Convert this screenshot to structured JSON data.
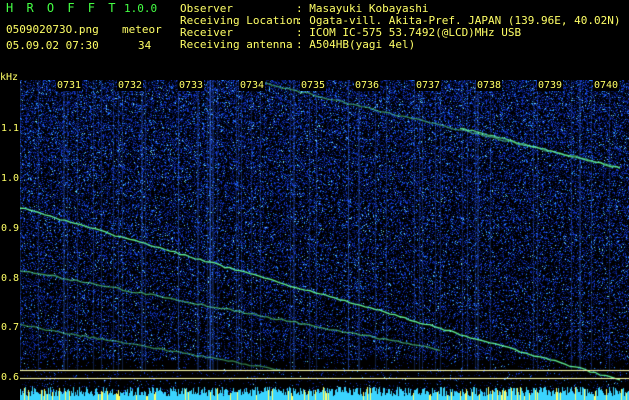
{
  "header": {
    "app_name": "H R O F F T",
    "version": "1.0.0",
    "filename": "050902073O.png",
    "meteor_label": "meteor",
    "datetime": "05.09.02 07:30",
    "meteor_count": "34"
  },
  "station": {
    "observer_label": "Observer",
    "observer_value": ": Masayuki Kobayashi",
    "location_label": "Receiving Location",
    "location_value": ": Ogata-vill. Akita-Pref. JAPAN (139.96E, 40.02N)",
    "receiver_label": "Receiver",
    "receiver_value": ": ICOM IC-575 53.7492(@LCD)MHz USB",
    "antenna_label": "Receiving antenna",
    "antenna_value": ": A504HB(yagi 4el)"
  },
  "axes": {
    "y_unit": "kHz",
    "y_ticks": [
      "1.1",
      "1.0",
      "0.9",
      "0.8",
      "0.7",
      "0.6"
    ],
    "x_ticks": [
      "0731",
      "0732",
      "0733",
      "0734",
      "0735",
      "0736",
      "0737",
      "0738",
      "0739",
      "0740"
    ]
  },
  "colors": {
    "background": "#000000",
    "noise_dark": "#04114a",
    "noise_mid": "#1a3bd0",
    "noise_light": "#3ad4ff",
    "trace": "#66ff99",
    "tick": "#ffff66",
    "baseline": "#ffffaa"
  }
}
